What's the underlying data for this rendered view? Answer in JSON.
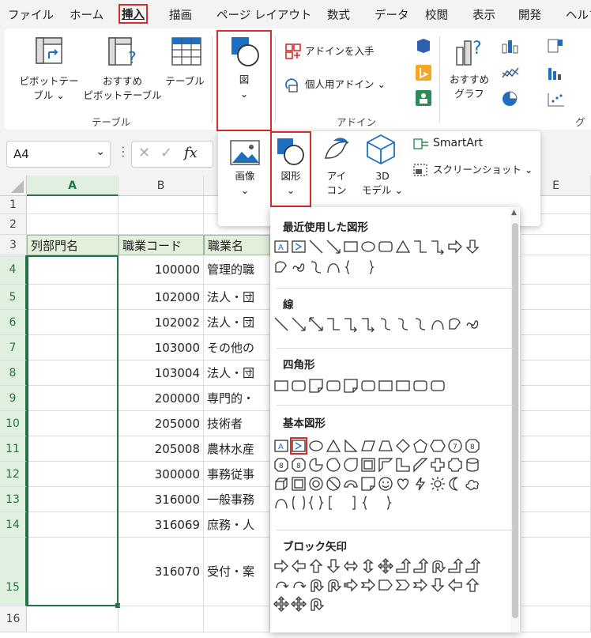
{
  "menu": [
    "ファイル",
    "ホーム",
    "挿入",
    "描画",
    "ページ レイアウト",
    "数式",
    "データ",
    "校閲",
    "表示",
    "開発",
    "ヘルプ"
  ],
  "ribbon": {
    "pivot_table": "ピボットテー\nブル ⌄",
    "pivot_line1": "ピボットテー",
    "pivot_line2": "ブル ⌄",
    "recommended_pivot_line1": "おすすめ",
    "recommended_pivot_line2": "ピボットテーブル",
    "table": "テーブル",
    "group_table": "テーブル",
    "illustrations": "図",
    "get_addins": "アドインを入手",
    "personal_addins": "個人用アドイン",
    "group_addins": "アドイン",
    "recommended_charts_line1": "おすすめ",
    "recommended_charts_line2": "グラフ",
    "group_charts": "グラ"
  },
  "namebox": "A4",
  "fx": "fx",
  "insert_dropdown": {
    "image": "画像",
    "shapes": "図形",
    "icons_line1": "アイ",
    "icons_line2": "コン",
    "model_line1": "3D",
    "model_line2": "モデル ⌄",
    "smartart": "SmartArt",
    "screenshot": "スクリーンショット ⌄"
  },
  "gallery": {
    "recent": "最近使用した図形",
    "lines": "線",
    "rectangles": "四角形",
    "basic": "基本図形",
    "block_arrows": "ブロック矢印"
  },
  "columns": [
    "A",
    "B",
    "E"
  ],
  "rows": [
    "1",
    "2",
    "3",
    "4",
    "5",
    "6",
    "7",
    "8",
    "9",
    "10",
    "11",
    "12",
    "13",
    "14",
    "15",
    "16"
  ],
  "header_row": {
    "a": "列部門名",
    "b": "職業コード",
    "c": "職業名"
  },
  "data_rows": [
    {
      "code": "100000",
      "name": "管理的職"
    },
    {
      "code": "102000",
      "name": "法人・団"
    },
    {
      "code": "102002",
      "name": "法人・団"
    },
    {
      "code": "103000",
      "name": "その他の"
    },
    {
      "code": "103004",
      "name": "法人・団"
    },
    {
      "code": "200000",
      "name": "専門的・"
    },
    {
      "code": "205000",
      "name": "技術者"
    },
    {
      "code": "205008",
      "name": "農林水産"
    },
    {
      "code": "300000",
      "name": "事務従事"
    },
    {
      "code": "316000",
      "name": "一般事務"
    },
    {
      "code": "316069",
      "name": "庶務・人"
    },
    {
      "code": "316070",
      "name": "受付・案"
    }
  ],
  "colors": {
    "accent_red": "#d32f2f",
    "header_green": "#e2efda",
    "icon_blue": "#1e6fc2",
    "selection_green": "#217346"
  }
}
